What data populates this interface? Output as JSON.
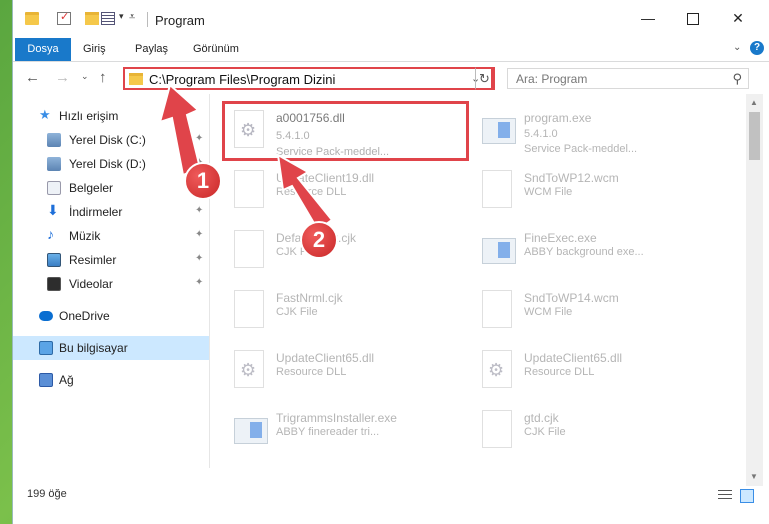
{
  "window": {
    "title": "Program",
    "min_glyph": "—",
    "close_glyph": "✕"
  },
  "ribbon": {
    "tabs": [
      "Dosya",
      "Giriş",
      "Paylaş",
      "Görünüm"
    ],
    "help_glyph": "?"
  },
  "nav": {
    "back": "←",
    "forward": "→",
    "recent": "⌄",
    "up": "↑",
    "address": "C:\\Program Files\\Program Dizini",
    "address_caret": "⌄",
    "refresh": "↻",
    "search_placeholder": "Ara: Program",
    "search_icon": "⚲"
  },
  "sidebar": {
    "items": [
      {
        "label": "Hızlı erişim",
        "icon": "star-icon",
        "pinned": false
      },
      {
        "label": "Yerel Disk (C:)",
        "icon": "disk-icon",
        "pinned": true
      },
      {
        "label": "Yerel Disk (D:)",
        "icon": "disk-icon",
        "pinned": true
      },
      {
        "label": "Belgeler",
        "icon": "documents-icon",
        "pinned": true
      },
      {
        "label": "İndirmeler",
        "icon": "download-icon",
        "pinned": true
      },
      {
        "label": "Müzik",
        "icon": "music-icon",
        "pinned": true
      },
      {
        "label": "Resimler",
        "icon": "pictures-icon",
        "pinned": true
      },
      {
        "label": "Videolar",
        "icon": "videos-icon",
        "pinned": true
      },
      {
        "label": "OneDrive",
        "icon": "onedrive-icon",
        "pinned": false
      },
      {
        "label": "Bu bilgisayar",
        "icon": "this-pc-icon",
        "pinned": false,
        "selected": true
      },
      {
        "label": "Ağ",
        "icon": "network-icon",
        "pinned": false
      }
    ],
    "pin_glyph": "📌"
  },
  "files": [
    {
      "name": "a0001756.dll",
      "line2": "5.4.1.0",
      "line3": "Service Pack-meddel...",
      "type": "dll",
      "highlighted": true
    },
    {
      "name": "program.exe",
      "line2": "5.4.1.0",
      "line3": "Service Pack-meddel...",
      "type": "exe"
    },
    {
      "name": "UpdateClient19.dll",
      "line2": "Resource DLL",
      "type": "file"
    },
    {
      "name": "SndToWP12.wcm",
      "line2": "WCM File",
      "type": "file"
    },
    {
      "name": "DefaultFont.cjk",
      "line2": "CJK File",
      "type": "file"
    },
    {
      "name": "FineExec.exe",
      "line2": "ABBY background exe...",
      "type": "exe"
    },
    {
      "name": "FastNrml.cjk",
      "line2": "CJK File",
      "type": "file"
    },
    {
      "name": "SndToWP14.wcm",
      "line2": "WCM File",
      "type": "file"
    },
    {
      "name": "UpdateClient65.dll",
      "line2": "Resource DLL",
      "type": "dll"
    },
    {
      "name": "UpdateClient65.dll",
      "line2": "Resource DLL",
      "type": "dll"
    },
    {
      "name": "TrigrammsInstaller.exe",
      "line2": "ABBY finereader tri...",
      "type": "exe"
    },
    {
      "name": "gtd.cjk",
      "line2": "CJK File",
      "type": "file"
    }
  ],
  "status": {
    "item_count": "199 öğe"
  },
  "callouts": [
    "1",
    "2"
  ],
  "colors": {
    "accent": "#1979ca",
    "highlight_red": "#e0444a",
    "selected_bg": "#cce8ff"
  }
}
